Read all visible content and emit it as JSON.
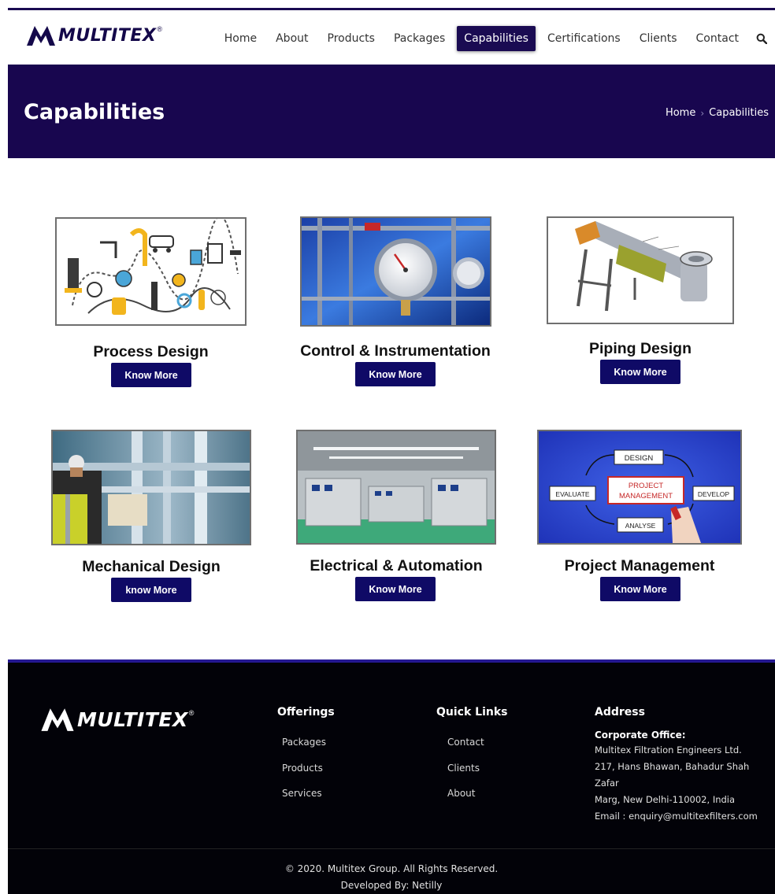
{
  "brand": {
    "name": "MULTITEX",
    "reg": "®"
  },
  "nav": {
    "items": [
      {
        "label": "Home",
        "active": false
      },
      {
        "label": "About",
        "active": false
      },
      {
        "label": "Products",
        "active": false
      },
      {
        "label": "Packages",
        "active": false
      },
      {
        "label": "Capabilities",
        "active": true
      },
      {
        "label": "Certifications",
        "active": false
      },
      {
        "label": "Clients",
        "active": false
      },
      {
        "label": "Contact",
        "active": false
      }
    ],
    "search_icon": "search-icon"
  },
  "banner": {
    "title": "Capabilities",
    "breadcrumb": {
      "home": "Home",
      "separator": "›",
      "current": "Capabilities"
    }
  },
  "cards": [
    {
      "title": "Process Design",
      "button": "Know More"
    },
    {
      "title": "Control & Instrumentation",
      "button": "Know More"
    },
    {
      "title": "Piping Design",
      "button": "Know More"
    },
    {
      "title": "Mechanical Design",
      "button": "know More"
    },
    {
      "title": "Electrical & Automation",
      "button": "Know More"
    },
    {
      "title": "Project Management",
      "button": "Know More"
    }
  ],
  "diagram": {
    "design": "DESIGN",
    "evaluate": "EVALUATE",
    "develop": "DEVELOP",
    "analyse": "ANALYSE",
    "center_line1": "PROJECT",
    "center_line2": "MANAGEMENT"
  },
  "footer": {
    "offerings": {
      "heading": "Offerings",
      "links": [
        "Packages",
        "Products",
        "Services"
      ]
    },
    "quick_links": {
      "heading": "Quick Links",
      "links": [
        "Contact",
        "Clients",
        "About"
      ]
    },
    "address": {
      "heading": "Address",
      "office_label": "Corporate Office:",
      "lines": [
        "Multitex Filtration Engineers Ltd.",
        "217, Hans Bhawan, Bahadur Shah Zafar",
        "Marg, New Delhi-110002, India",
        "Email : enquiry@multitexfilters.com"
      ]
    },
    "copyright": "© 2020. Multitex Group. All Rights Reserved.",
    "developed_by": "Developed By: Netilly"
  },
  "colors": {
    "brand_navy": "#18064f",
    "button_blue": "#0f0a66",
    "footer_bg": "#020208",
    "footer_accent": "#241890"
  }
}
